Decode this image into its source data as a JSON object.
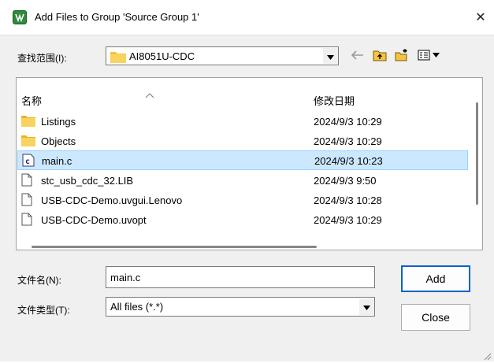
{
  "window": {
    "title": "Add Files to Group 'Source Group 1'",
    "close_glyph": "✕"
  },
  "look_in": {
    "label": "查找范围(I):",
    "value": "AI8051U-CDC"
  },
  "list": {
    "columns": {
      "name": "名称",
      "date": "修改日期"
    },
    "rows": [
      {
        "name": "Listings",
        "date": "2024/9/3 10:29",
        "icon": "folder-icon"
      },
      {
        "name": "Objects",
        "date": "2024/9/3 10:29",
        "icon": "folder-icon"
      },
      {
        "name": "main.c",
        "date": "2024/9/3 10:23",
        "icon": "c-source-file-icon",
        "selected": true
      },
      {
        "name": "stc_usb_cdc_32.LIB",
        "date": "2024/9/3 9:50",
        "icon": "file-icon"
      },
      {
        "name": "USB-CDC-Demo.uvgui.Lenovo",
        "date": "2024/9/3 10:28",
        "icon": "file-icon"
      },
      {
        "name": "USB-CDC-Demo.uvopt",
        "date": "2024/9/3 10:29",
        "icon": "file-icon"
      }
    ]
  },
  "file_name": {
    "label": "文件名(N):",
    "value": "main.c"
  },
  "file_type": {
    "label": "文件类型(T):",
    "value": "All files (*.*)"
  },
  "buttons": {
    "add": "Add",
    "close": "Close"
  },
  "colors": {
    "selection_bg": "#cce8ff",
    "selection_border": "#99d1ff",
    "folder": "#f5c342",
    "dialog_bg": "#f0f0f0",
    "app_icon": "#2f8a3c"
  }
}
